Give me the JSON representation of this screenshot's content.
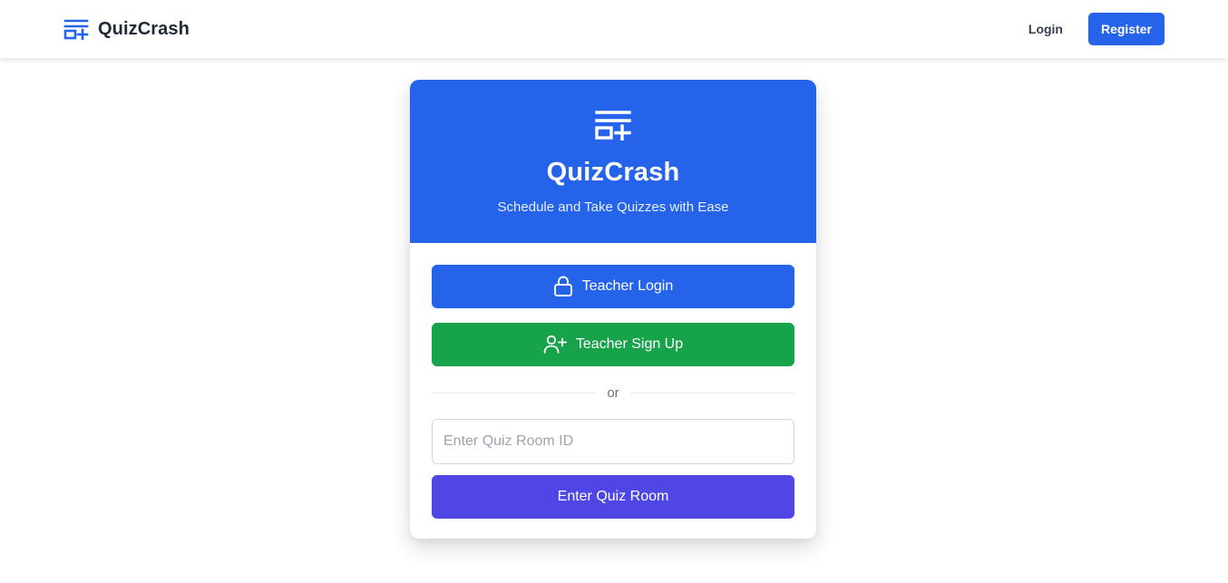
{
  "navbar": {
    "brand_name": "QuizCrash",
    "brand_icon": "quiz-logo-icon",
    "login_label": "Login",
    "register_label": "Register"
  },
  "card": {
    "title": "QuizCrash",
    "subtitle": "Schedule and Take Quizzes with Ease",
    "hero_icon": "quiz-logo-icon",
    "teacher_login_label": "Teacher Login",
    "teacher_login_icon": "lock-icon",
    "teacher_signup_label": "Teacher Sign Up",
    "teacher_signup_icon": "user-plus-icon",
    "divider_text": "or",
    "room_input": {
      "placeholder": "Enter Quiz Room ID",
      "value": ""
    },
    "enter_room_label": "Enter Quiz Room"
  },
  "colors": {
    "primary": "#2563eb",
    "success": "#16a34a",
    "indigo": "#4f46e5"
  }
}
